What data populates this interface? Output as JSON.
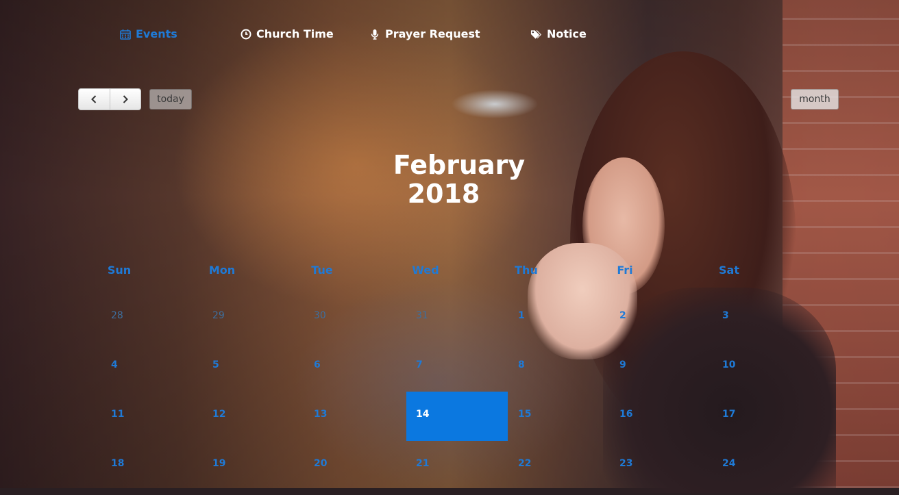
{
  "nav": {
    "items": [
      {
        "label": "Events",
        "icon": "calendar-icon",
        "active": true
      },
      {
        "label": "Church Time",
        "icon": "clock-icon",
        "active": false
      },
      {
        "label": "Prayer Request",
        "icon": "microphone-icon",
        "active": false
      },
      {
        "label": "Notice",
        "icon": "tags-icon",
        "active": false
      }
    ]
  },
  "toolbar": {
    "prev_icon": "chevron-left-icon",
    "next_icon": "chevron-right-icon",
    "today_label": "today",
    "month_label": "month"
  },
  "calendar": {
    "month": "February",
    "year": "2018",
    "weekdays": [
      "Sun",
      "Mon",
      "Tue",
      "Wed",
      "Thu",
      "Fri",
      "Sat"
    ],
    "weeks": [
      [
        "28",
        "29",
        "30",
        "31",
        "1",
        "2",
        "3"
      ],
      [
        "4",
        "5",
        "6",
        "7",
        "8",
        "9",
        "10"
      ],
      [
        "11",
        "12",
        "13",
        "14",
        "15",
        "16",
        "17"
      ],
      [
        "18",
        "19",
        "20",
        "21",
        "22",
        "23",
        "24"
      ]
    ],
    "today": "14",
    "accent_color": "#1f7ad6",
    "today_color": "#0b78e0"
  }
}
